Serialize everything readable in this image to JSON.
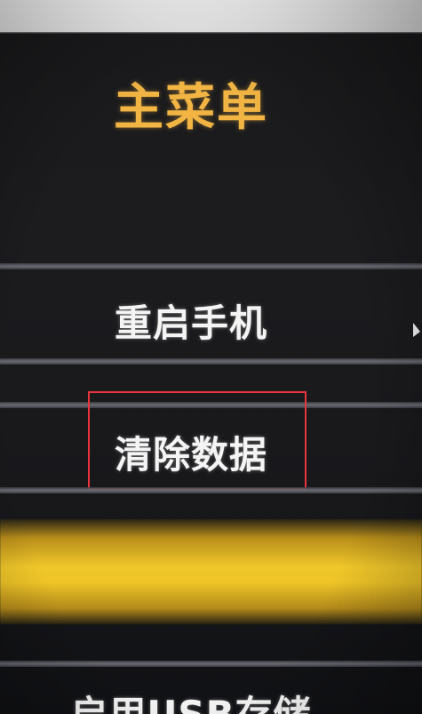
{
  "menu": {
    "title": "主菜单",
    "items": [
      {
        "label": "重启手机",
        "selected": false
      },
      {
        "label": "清除数据",
        "selected": true
      },
      {
        "label": "",
        "selected": false
      },
      {
        "label": "启用USB存储",
        "selected": false
      }
    ]
  },
  "colors": {
    "title": "#f2b544",
    "item_text": "#f4f4f4",
    "focus_border": "#e8343c",
    "highlight": "#f0c72a",
    "background": "#1a1a1c"
  }
}
